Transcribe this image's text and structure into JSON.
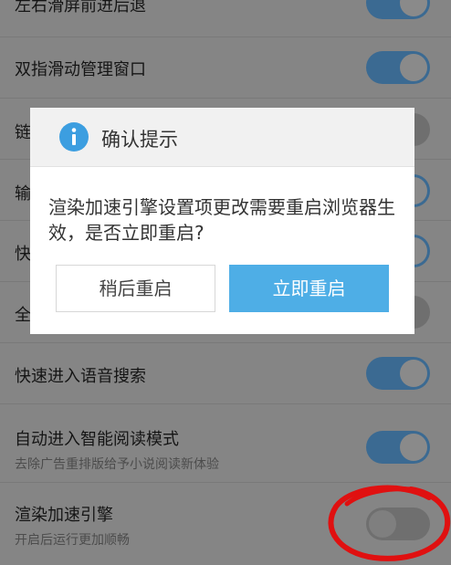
{
  "settings": [
    {
      "title": "左右滑屏前进后退",
      "subtitle": "",
      "toggle": "on"
    },
    {
      "title": "双指滑动管理窗口",
      "subtitle": "",
      "toggle": "on"
    },
    {
      "title": "链",
      "subtitle": "",
      "toggle": "off"
    },
    {
      "title": "输",
      "subtitle": "",
      "toggle": "on"
    },
    {
      "title": "快",
      "subtitle": "",
      "toggle": "on"
    },
    {
      "title": "全",
      "subtitle": "",
      "toggle": "off"
    },
    {
      "title": "快速进入语音搜索",
      "subtitle": "",
      "toggle": "on"
    },
    {
      "title": "自动进入智能阅读模式",
      "subtitle": "去除广告重排版给予小说阅读新体验",
      "toggle": "on"
    },
    {
      "title": "渲染加速引擎",
      "subtitle": "开启后运行更加顺畅",
      "toggle": "off"
    }
  ],
  "dialog": {
    "icon": "info-icon",
    "title": "确认提示",
    "message": "渲染加速引擎设置项更改需要重启浏览器生效，是否立即重启?",
    "later_label": "稍后重启",
    "now_label": "立即重启"
  },
  "colors": {
    "toggle_on": "#3b6a92",
    "toggle_off": "#6f6f6f",
    "primary_button": "#4eaee6",
    "info_icon": "#3c9ee0",
    "annotation": "#e01010"
  }
}
